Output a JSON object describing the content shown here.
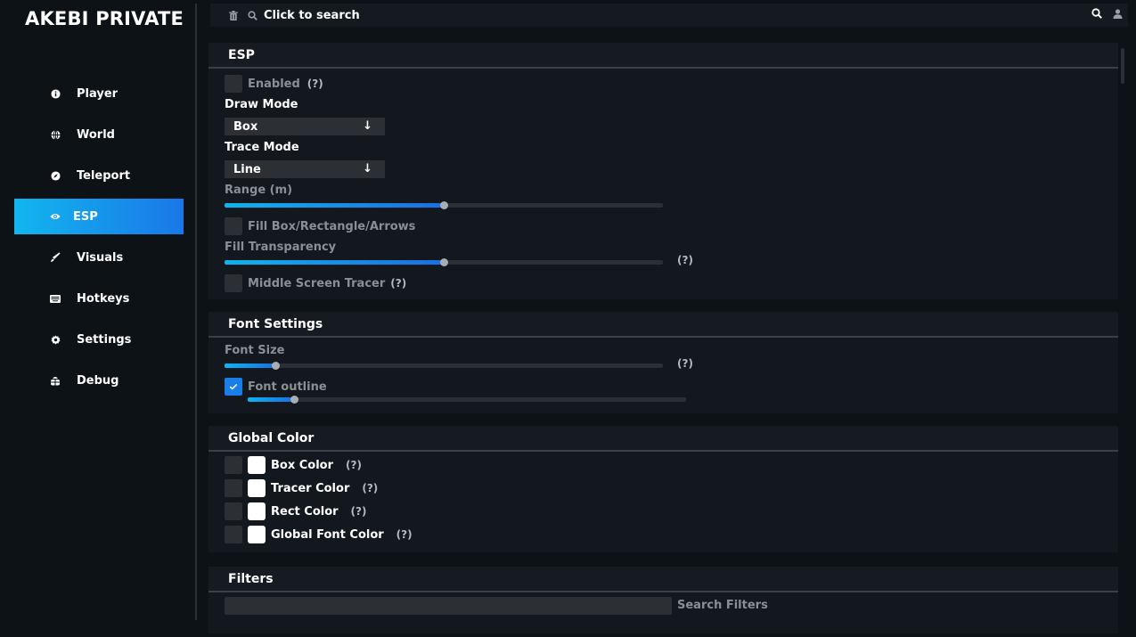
{
  "app": {
    "title": "AKEBI PRIVATE"
  },
  "sidebar": {
    "items": [
      {
        "label": "Player",
        "icon": "info-icon"
      },
      {
        "label": "World",
        "icon": "globe-icon"
      },
      {
        "label": "Teleport",
        "icon": "compass-icon"
      },
      {
        "label": "ESP",
        "icon": "eye-icon",
        "active": true
      },
      {
        "label": "Visuals",
        "icon": "brush-icon"
      },
      {
        "label": "Hotkeys",
        "icon": "keyboard-icon"
      },
      {
        "label": "Settings",
        "icon": "gear-icon"
      },
      {
        "label": "Debug",
        "icon": "bug-icon"
      }
    ]
  },
  "topbar": {
    "search_placeholder": "Click to search"
  },
  "esp": {
    "title": "ESP",
    "enabled_label": "Enabled",
    "enabled_help": "(?)",
    "draw_mode_label": "Draw Mode",
    "draw_mode_value": "Box",
    "trace_mode_label": "Trace Mode",
    "trace_mode_value": "Line",
    "range_label": "Range (m)",
    "range_fraction": 0.5,
    "fill_label": "Fill Box/Rectangle/Arrows",
    "fill_transparency_label": "Fill Transparency",
    "fill_transparency_fraction": 0.5,
    "fill_transparency_help": "(?)",
    "middle_tracer_label": "Middle Screen Tracer",
    "middle_tracer_help": "(?)"
  },
  "font_settings": {
    "title": "Font Settings",
    "font_size_label": "Font Size",
    "font_size_fraction": 0.115,
    "font_size_help": "(?)",
    "outline_label": "Font outline",
    "outline_checked": true,
    "outline_fraction": 0.105
  },
  "global_color": {
    "title": "Global Color",
    "items": [
      {
        "label": "Box Color",
        "help": "(?)"
      },
      {
        "label": "Tracer Color",
        "help": "(?)"
      },
      {
        "label": "Rect Color",
        "help": "(?)"
      },
      {
        "label": "Global Font Color",
        "help": "(?)"
      }
    ]
  },
  "filters": {
    "title": "Filters",
    "search_label": "Search Filters"
  },
  "colors": {
    "accent_start": "#12b6ee",
    "accent_end": "#1a77e8",
    "background": "#0d1217",
    "panel": "#12181d"
  }
}
